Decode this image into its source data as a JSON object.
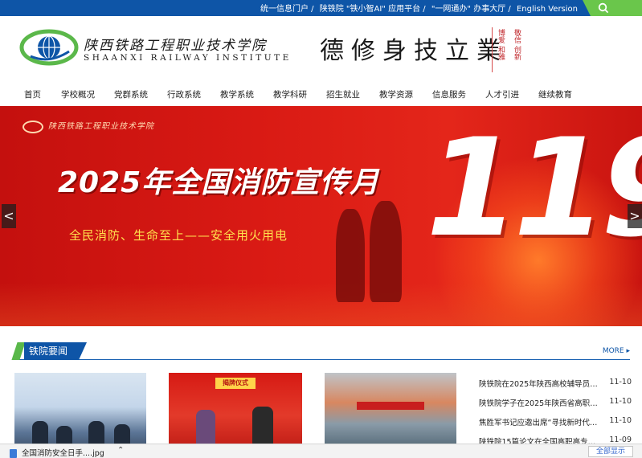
{
  "topbar": {
    "links": [
      "统一信息门户 /",
      "陕铁院 \"铁小智AI\" 应用平台 /",
      "\"一网通办\" 办事大厅 /",
      "English Version"
    ],
    "search_icon": "search-icon",
    "color": "#0e55a7",
    "search_color": "#6ac64b"
  },
  "header": {
    "logo_cn": "陕西铁路工程职业技术学院",
    "logo_en": "SHAANXI RAILWAY INSTITUTE",
    "motto": "德修身技立業",
    "seal_left": "博爱 和雅",
    "seal_right": "敬信 创新"
  },
  "nav": {
    "items": [
      "首页",
      "学校概况",
      "党群系统",
      "行政系统",
      "教学系统",
      "教学科研",
      "招生就业",
      "教学资源",
      "信息服务",
      "人才引进",
      "继续教育"
    ]
  },
  "banner": {
    "logo_text": "陕西铁路工程职业技术学院",
    "title": "2025年全国消防宣传月",
    "subtitle": "全民消防、生命至上——安全用火用电",
    "number": "119",
    "prev": "<",
    "next": ">"
  },
  "news_section": {
    "title": "铁院要闻",
    "more": "MORE ▸",
    "photo2_sign": "揭牌仪式",
    "items": [
      {
        "title": "陕铁院在2025年陕西高校辅导员素…",
        "date": "11-10"
      },
      {
        "title": "陕铁院学子在2025年陕西省高职高…",
        "date": "11-10"
      },
      {
        "title": "焦胜军书记应邀出席“寻找新时代…",
        "date": "11-10"
      },
      {
        "title": "陕铁院15篇论文在全国高职高专…",
        "date": "11-09"
      }
    ]
  },
  "download_bar": {
    "file": "全国消防安全日手....jpg",
    "chevron": "⌃",
    "show_all": "全部显示"
  }
}
